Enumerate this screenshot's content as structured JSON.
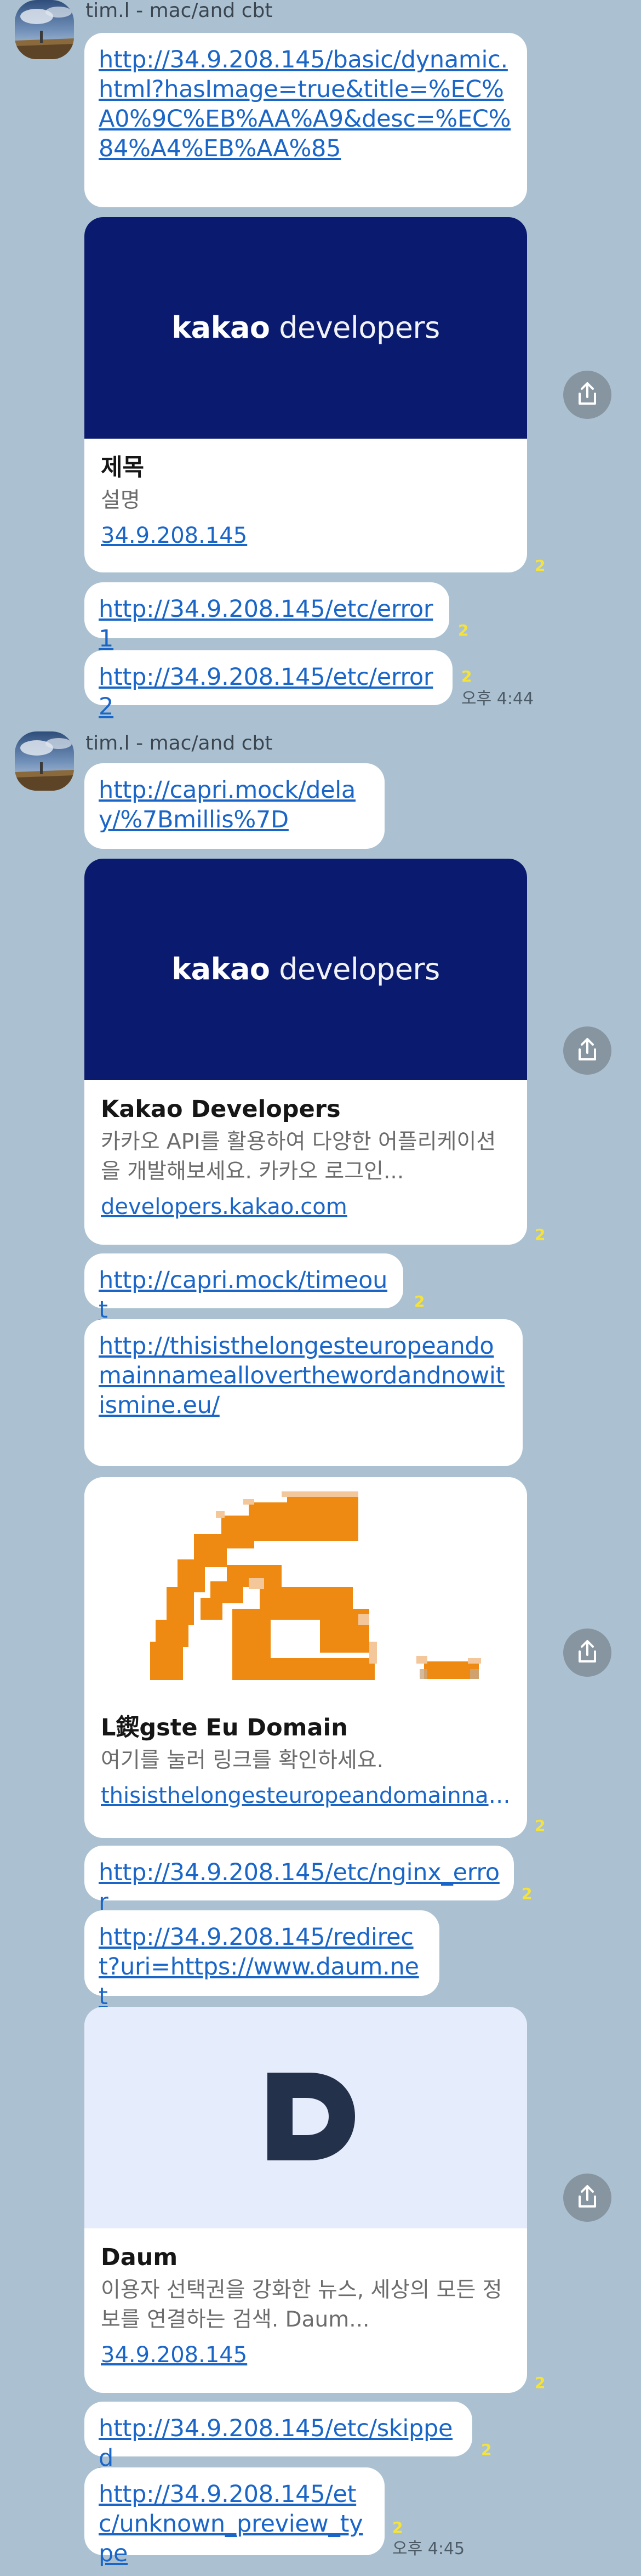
{
  "colors": {
    "background": "#abc1d1",
    "link": "#1a66c8",
    "kakao_navy": "#0a1b6f",
    "unread_badge": "#f5e33a",
    "daum_bg": "#e5ecfb",
    "daum_logo": "#24314a",
    "orange": "#ee8a12"
  },
  "groups": [
    {
      "sender": "tim.l - mac/and cbt",
      "time": "오후 4:44"
    },
    {
      "sender": "tim.l - mac/and cbt",
      "time": "오후 4:45"
    }
  ],
  "messages": {
    "m1": {
      "text": "http://34.9.208.145/basic/dynamic.html?hasImage=true&title=%EC%A0%9C%EB%AA%A9&desc=%EC%84%A4%EB%AA%85"
    },
    "card1": {
      "image": "kakao-developers-logo",
      "logo_word1": "kakao",
      "logo_word2": "developers",
      "title": "제목",
      "desc": "설명",
      "domain": "34.9.208.145",
      "unread": "2"
    },
    "m2": {
      "text": "http://34.9.208.145/etc/error1",
      "unread": "2"
    },
    "m3": {
      "text": "http://34.9.208.145/etc/error2",
      "unread": "2"
    },
    "m4": {
      "text": "http://capri.mock/delay/%7Bmillis%7D"
    },
    "card2": {
      "image": "kakao-developers-logo",
      "logo_word1": "kakao",
      "logo_word2": "developers",
      "title": "Kakao Developers",
      "desc": "카카오 API를 활용하여 다양한 어플리케이션을 개발해보세요. 카카오 로그인...",
      "domain": "developers.kakao.com",
      "unread": "2"
    },
    "m5": {
      "text": "http://capri.mock/timeout",
      "unread": "2"
    },
    "m6": {
      "text": "http://thisisthelongesteuropeandomainnamealloverthewordandnowitismine.eu/"
    },
    "card3": {
      "image": "eu-domain-pixel-logo",
      "title": "L鍥gste Eu Domain",
      "desc": "여기를 눌러 링크를 확인하세요.",
      "domain": "thisisthelongesteuropeandomainnam...",
      "unread": "2"
    },
    "m7": {
      "text": "http://34.9.208.145/etc/nginx_error",
      "unread": "2"
    },
    "m8": {
      "text": "http://34.9.208.145/redirect?uri=https://www.daum.net"
    },
    "card4": {
      "image": "daum-logo",
      "logo_letter": "D",
      "title": "Daum",
      "desc": "이용자 선택권을 강화한 뉴스, 세상의 모든 정보를 연결하는 검색. Daum...",
      "domain": "34.9.208.145",
      "unread": "2"
    },
    "m9": {
      "text": "http://34.9.208.145/etc/skipped",
      "unread": "2"
    },
    "m10": {
      "text": "http://34.9.208.145/etc/unknown_preview_type",
      "unread": "2"
    }
  },
  "icons": {
    "share": "share-icon",
    "avatar": "profile-avatar"
  }
}
